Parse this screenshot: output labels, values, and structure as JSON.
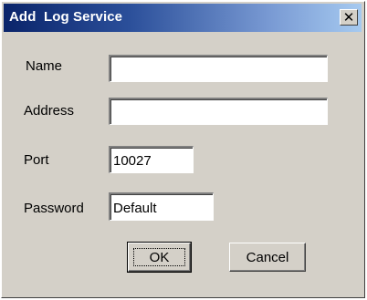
{
  "dialog": {
    "title": "Add  Log Service",
    "close_glyph": "✕"
  },
  "fields": {
    "name": {
      "label": "Name",
      "value": ""
    },
    "address": {
      "label": "Address",
      "value": ""
    },
    "port": {
      "label": "Port",
      "value": "10027"
    },
    "password": {
      "label": "Password",
      "value": "Default"
    }
  },
  "buttons": {
    "ok_label": "OK",
    "cancel_label": "Cancel"
  }
}
